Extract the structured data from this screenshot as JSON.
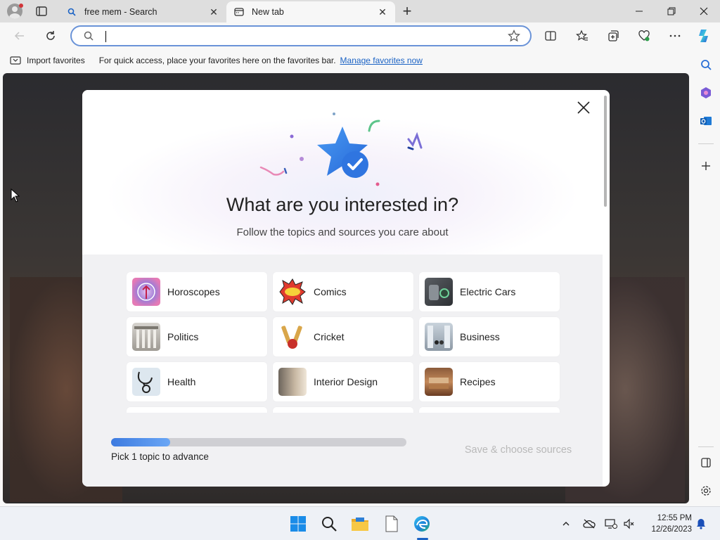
{
  "browser": {
    "tabs": [
      {
        "title": "free mem - Search",
        "active": false
      },
      {
        "title": "New tab",
        "active": true
      }
    ],
    "address": {
      "value": "",
      "placeholder": ""
    },
    "favorites_bar": {
      "import_label": "Import favorites",
      "message": "For quick access, place your favorites here on the favorites bar.",
      "link": "Manage favorites now"
    }
  },
  "modal": {
    "title": "What are you interested in?",
    "subtitle": "Follow the topics and sources you care about",
    "topics": [
      {
        "label": "Horoscopes",
        "icon": "horoscope-icon"
      },
      {
        "label": "Comics",
        "icon": "comics-icon"
      },
      {
        "label": "Electric Cars",
        "icon": "electric-cars-icon"
      },
      {
        "label": "Politics",
        "icon": "politics-icon"
      },
      {
        "label": "Cricket",
        "icon": "cricket-icon"
      },
      {
        "label": "Business",
        "icon": "business-icon"
      },
      {
        "label": "Health",
        "icon": "health-icon"
      },
      {
        "label": "Interior Design",
        "icon": "interior-design-icon"
      },
      {
        "label": "Recipes",
        "icon": "recipes-icon"
      }
    ],
    "progress": {
      "fraction": 0.2,
      "label": "Pick 1 topic to advance"
    },
    "save_button": "Save & choose sources"
  },
  "taskbar": {
    "time": "12:55 PM",
    "date": "12/26/2023"
  },
  "colors": {
    "accent": "#1a62c4",
    "address_border": "#6a93d8",
    "progress": "#3d7be0",
    "star": "#3a84e8"
  }
}
